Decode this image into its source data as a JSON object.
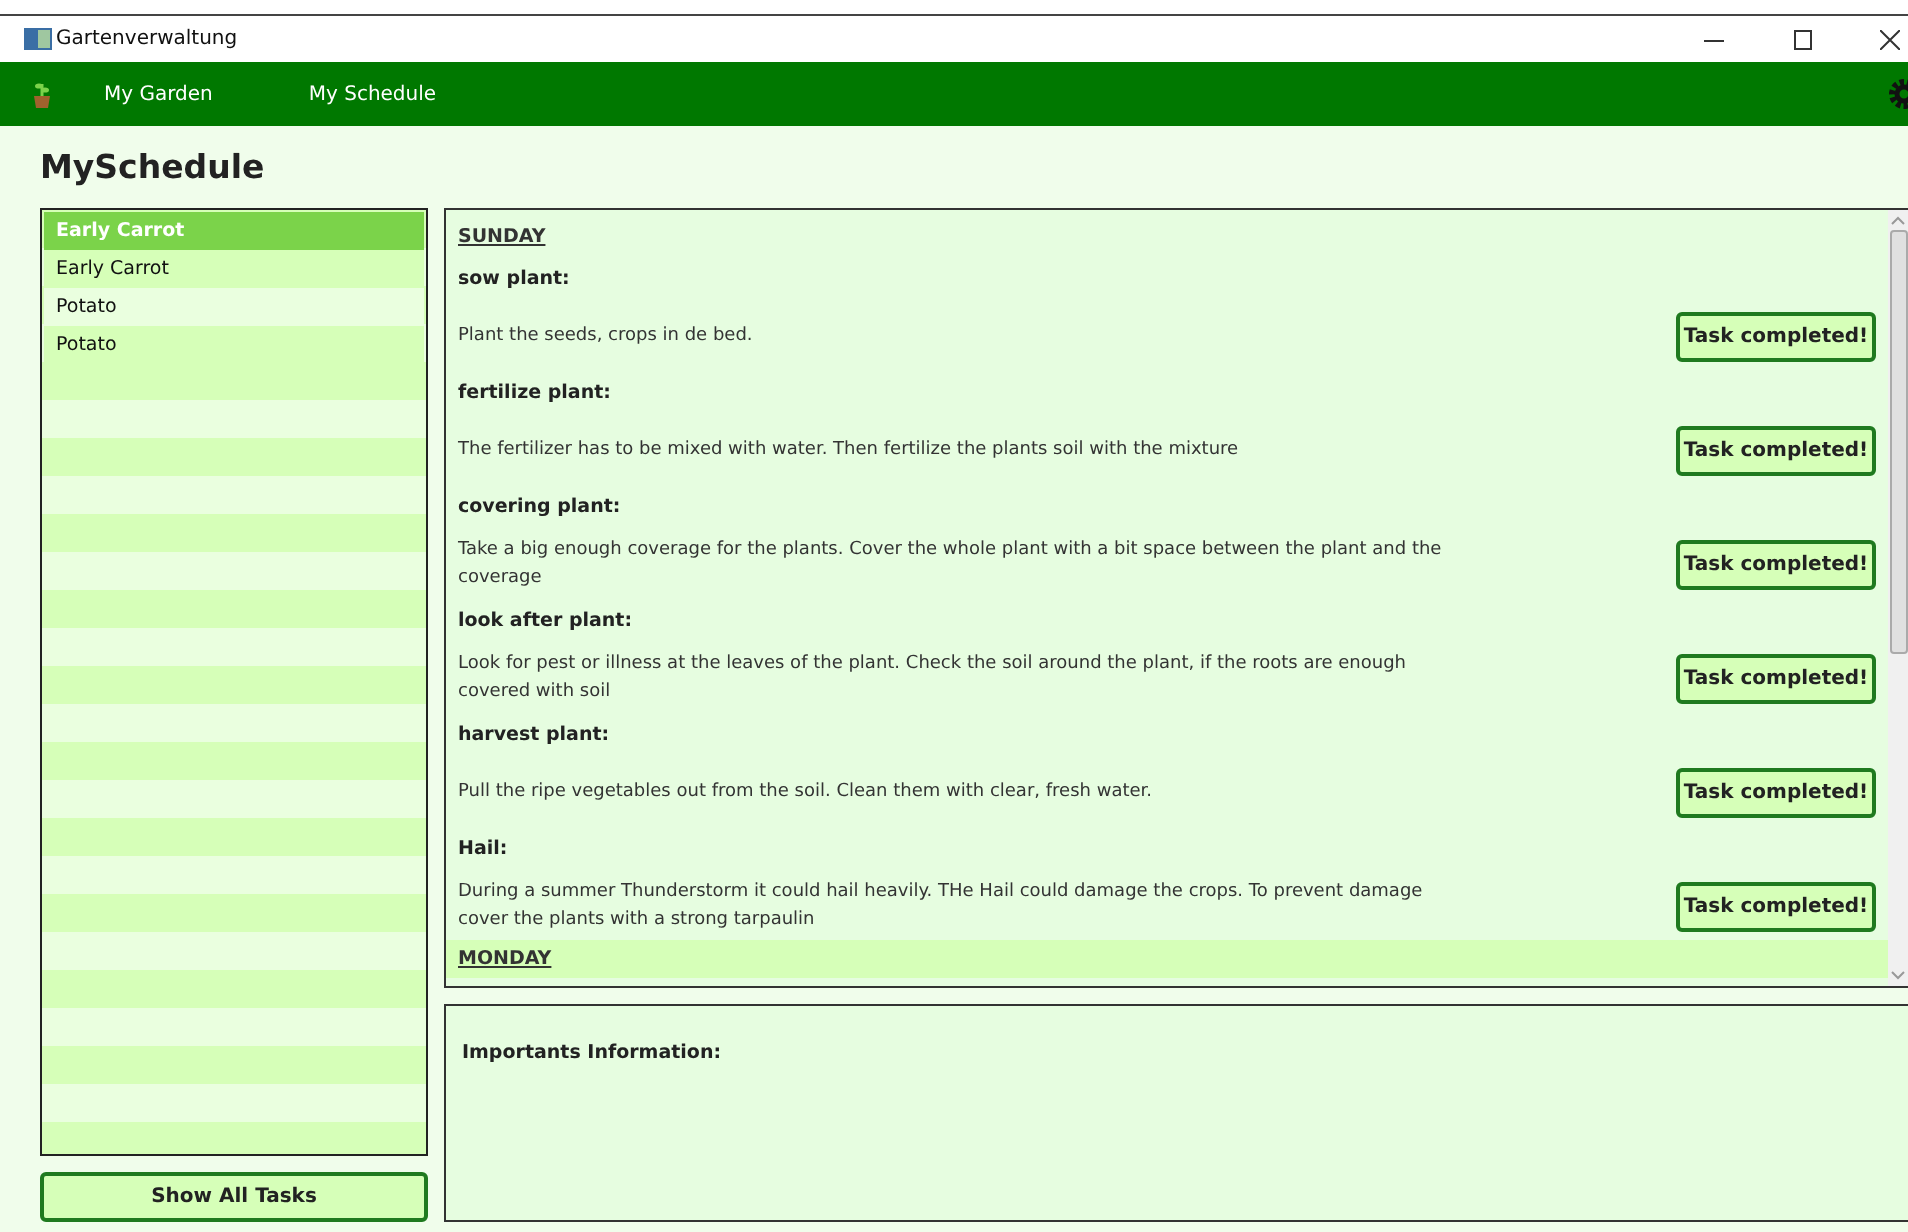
{
  "window": {
    "title": "Gartenverwaltung"
  },
  "nav": {
    "items": [
      {
        "label": "My Garden"
      },
      {
        "label": "My Schedule"
      }
    ]
  },
  "heading": "MySchedule",
  "plants": [
    {
      "name": "Early Carrot",
      "selected": true
    },
    {
      "name": "Early Carrot",
      "selected": false
    },
    {
      "name": "Potato",
      "selected": false
    },
    {
      "name": "Potato",
      "selected": false
    }
  ],
  "show_all_button": "Show All Tasks",
  "schedule": [
    {
      "day": "SUNDAY",
      "tasks": [
        {
          "title": "sow plant:",
          "description": "Plant the seeds, crops in de bed.",
          "button": "Task completed!"
        },
        {
          "title": "fertilize plant:",
          "description": "The fertilizer has to be mixed with water. Then fertilize the plants soil with the mixture",
          "button": "Task completed!"
        },
        {
          "title": "covering plant:",
          "description": "Take a big enough coverage for the plants. Cover the whole plant with a bit space between the plant and the coverage",
          "button": "Task completed!"
        },
        {
          "title": "look after plant:",
          "description": "Look for pest or illness at the leaves of the plant. Check the soil around the plant, if the roots are enough covered with soil",
          "button": "Task completed!"
        },
        {
          "title": "harvest plant:",
          "description": "Pull the ripe vegetables out from the soil. Clean them with clear, fresh water.",
          "button": "Task completed!"
        },
        {
          "title": "Hail:",
          "description": "During a summer Thunderstorm it could hail heavily. THe Hail could damage the crops. To prevent damage cover the plants with a strong tarpaulin",
          "button": "Task completed!"
        }
      ]
    },
    {
      "day": "MONDAY"
    }
  ],
  "info": {
    "label": "Importants Information:"
  }
}
